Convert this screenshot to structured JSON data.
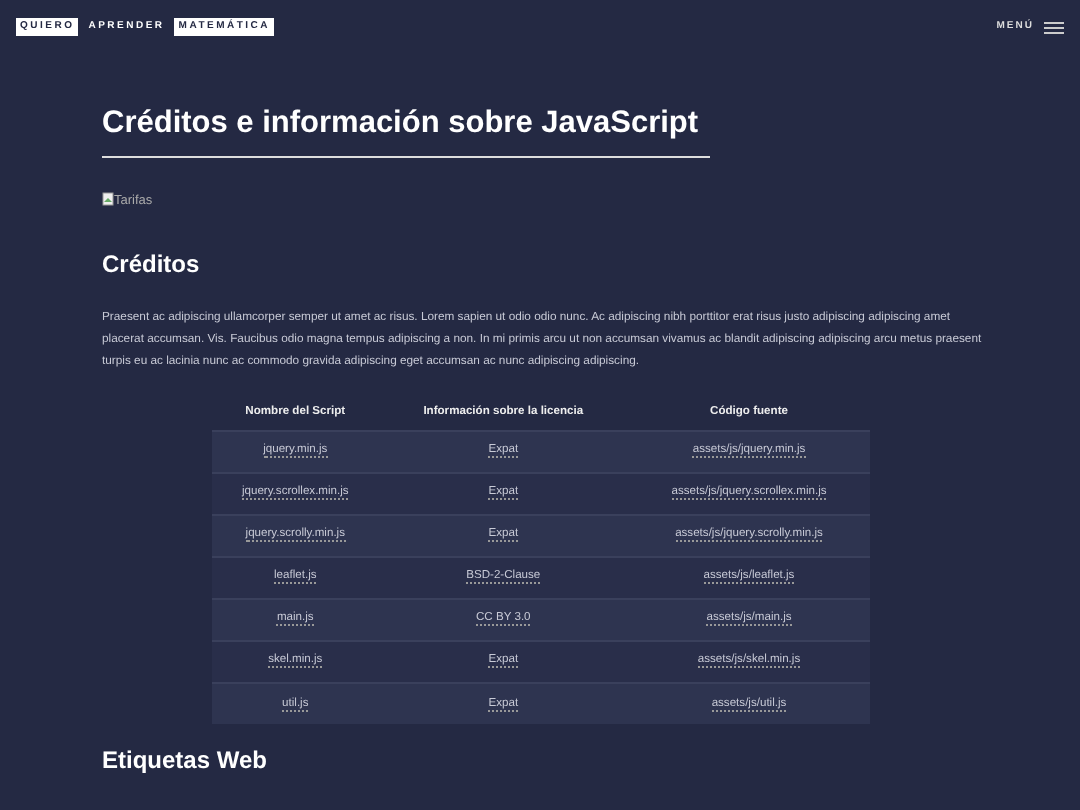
{
  "header": {
    "logo": [
      "QUIERO",
      "APRENDER",
      "MATEMÁTICA"
    ],
    "menu": "MENÚ"
  },
  "title": "Créditos e información sobre JavaScript",
  "image_alt": "Tarifas",
  "section": {
    "heading": "Créditos",
    "paragraph": "Praesent ac adipiscing ullamcorper semper ut amet ac risus. Lorem sapien ut odio odio nunc. Ac adipiscing nibh porttitor erat risus justo adipiscing adipiscing amet placerat accumsan. Vis. Faucibus odio magna tempus adipiscing a non. In mi primis arcu ut non accumsan vivamus ac blandit adipiscing adipiscing arcu metus praesent turpis eu ac lacinia nunc ac commodo gravida adipiscing eget accumsan ac nunc adipiscing adipiscing."
  },
  "table": {
    "columns": [
      "Nombre del Script",
      "Información sobre la licencia",
      "Código fuente"
    ],
    "rows": [
      [
        "jquery.min.js",
        "Expat",
        "assets/js/jquery.min.js"
      ],
      [
        "jquery.scrollex.min.js",
        "Expat",
        "assets/js/jquery.scrollex.min.js"
      ],
      [
        "jquery.scrolly.min.js",
        "Expat",
        "assets/js/jquery.scrolly.min.js"
      ],
      [
        "leaflet.js",
        "BSD-2-Clause",
        "assets/js/leaflet.js"
      ],
      [
        "main.js",
        "CC BY 3.0",
        "assets/js/main.js"
      ],
      [
        "skel.min.js",
        "Expat",
        "assets/js/skel.min.js"
      ],
      [
        "util.js",
        "Expat",
        "assets/js/util.js"
      ]
    ]
  },
  "next_heading": "Etiquetas Web"
}
